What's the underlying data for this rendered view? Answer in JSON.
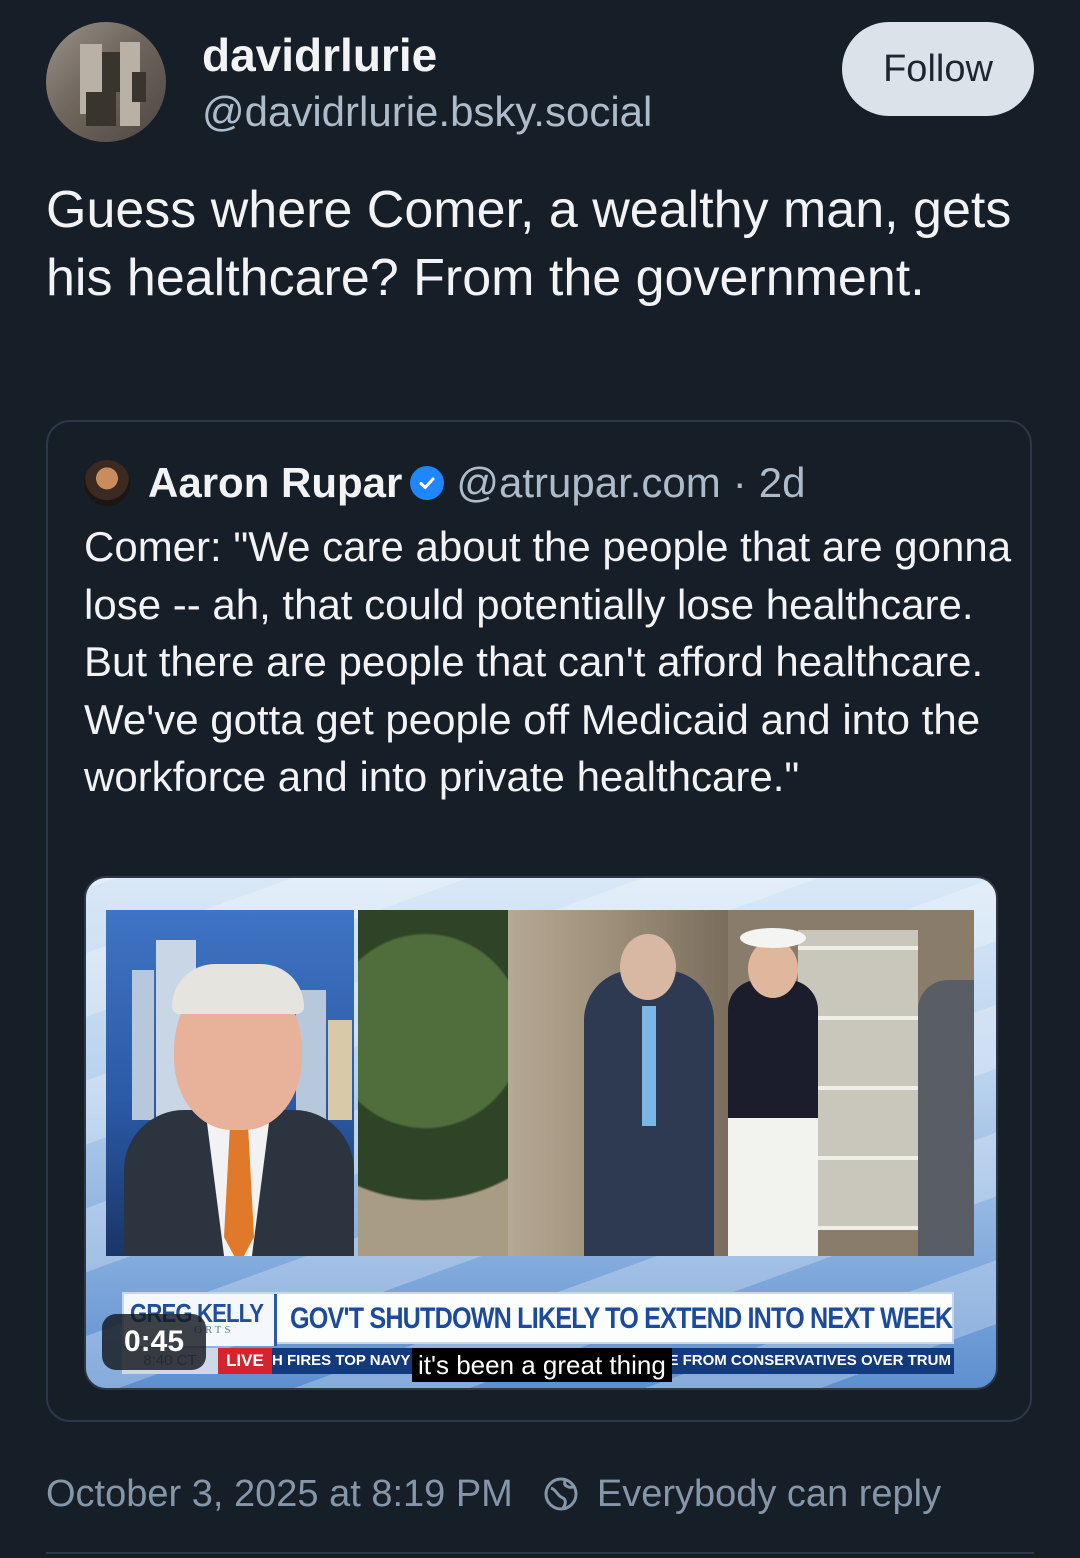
{
  "post": {
    "author": {
      "display_name": "davidrlurie",
      "handle": "@davidrlurie.bsky.social",
      "avatar_icon": "avatar-image"
    },
    "follow_label": "Follow",
    "text": "Guess where Comer, a wealthy man, gets his healthcare? From the government.",
    "timestamp": "October 3, 2025 at 8:19 PM",
    "reply_setting": "Everybody can reply",
    "reply_icon": "globe-icon"
  },
  "quote": {
    "author": {
      "display_name": "Aaron Rupar",
      "handle": "@atrupar.com",
      "verified_icon": "verified-check-icon"
    },
    "separator": "·",
    "age": "2d",
    "text": "Comer: \"We care about the people that are gonna lose -- ah, that could potentially lose healthcare. But there are people that can't afford healthcare. We've gotta get people off Medicaid and into the workforce and into private healthcare.\"",
    "video": {
      "duration": "0:45",
      "caption": "it's been a great thing",
      "lower_third": {
        "show_name": "GREG KELLY",
        "show_sub": "ORTS",
        "headline": "GOV'T SHUTDOWN LIKELY TO EXTEND INTO NEXT WEEK",
        "clock": "8:40 CT",
        "live": "LIVE",
        "ticker": "H FIRES TOP NAVY",
        "ticker_tail": "E FROM CONSERVATIVES OVER TRUMP"
      }
    }
  },
  "colors": {
    "background": "#161e27",
    "text_primary": "#f1f3f5",
    "text_secondary": "#aebbc9",
    "muted": "#8596a9",
    "follow_bg": "#dce2ea",
    "verified": "#1f86ff"
  }
}
